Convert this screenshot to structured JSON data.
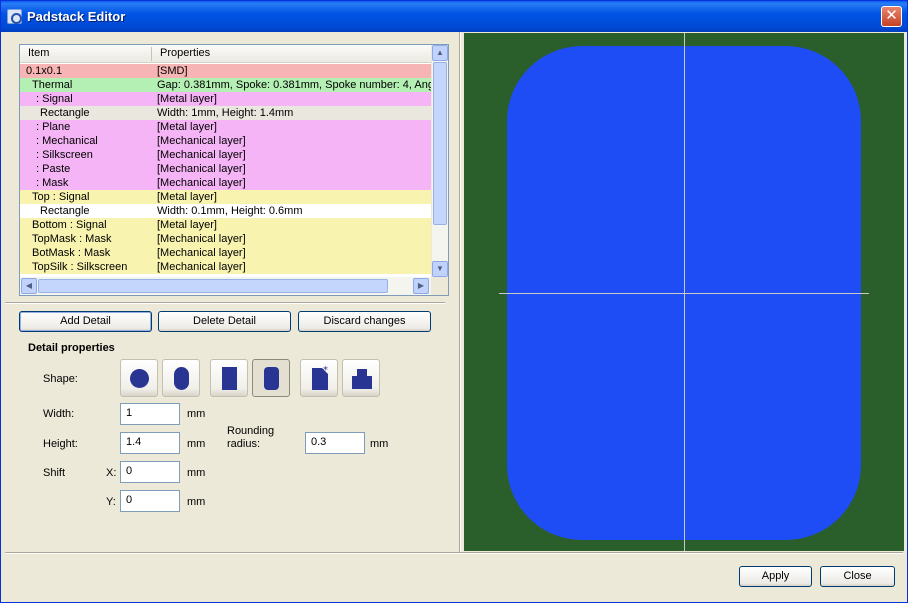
{
  "window": {
    "title": "Padstack Editor",
    "close_glyph": "✕"
  },
  "tree": {
    "columns": [
      "Item",
      "Properties"
    ],
    "rows": [
      {
        "item": "0.1x0.1",
        "props": "[SMD]",
        "bg": "#f7b4b4",
        "indent": 0
      },
      {
        "item": "Thermal",
        "props": "Gap: 0.381mm, Spoke: 0.381mm, Spoke number: 4, Ang",
        "bg": "#b4f0b4",
        "indent": 1
      },
      {
        "item": ": Signal",
        "props": "[Metal layer]",
        "bg": "#f5b4f5",
        "indent": 2
      },
      {
        "item": "Rectangle",
        "props": "Width: 1mm, Height: 1.4mm",
        "bg": "#e9e7de",
        "indent": 3
      },
      {
        "item": ": Plane",
        "props": "[Metal layer]",
        "bg": "#f5b4f5",
        "indent": 2
      },
      {
        "item": ": Mechanical",
        "props": "[Mechanical layer]",
        "bg": "#f5b4f5",
        "indent": 2
      },
      {
        "item": ": Silkscreen",
        "props": "[Mechanical layer]",
        "bg": "#f5b4f5",
        "indent": 2
      },
      {
        "item": ": Paste",
        "props": "[Mechanical layer]",
        "bg": "#f5b4f5",
        "indent": 2
      },
      {
        "item": ": Mask",
        "props": "[Mechanical layer]",
        "bg": "#f5b4f5",
        "indent": 2
      },
      {
        "item": "Top : Signal",
        "props": "[Metal layer]",
        "bg": "#f8f4b0",
        "indent": 1
      },
      {
        "item": "Rectangle",
        "props": "Width: 0.1mm, Height: 0.6mm",
        "bg": "#ffffff",
        "indent": 3
      },
      {
        "item": "Bottom : Signal",
        "props": "[Metal layer]",
        "bg": "#f8f4b0",
        "indent": 1
      },
      {
        "item": "TopMask : Mask",
        "props": "[Mechanical layer]",
        "bg": "#f8f4b0",
        "indent": 1
      },
      {
        "item": "BotMask : Mask",
        "props": "[Mechanical layer]",
        "bg": "#f8f4b0",
        "indent": 1
      },
      {
        "item": "TopSilk : Silkscreen",
        "props": "[Mechanical layer]",
        "bg": "#f8f4b0",
        "indent": 1
      }
    ]
  },
  "buttons": {
    "add_detail": "Add Detail",
    "delete_detail": "Delete Detail",
    "discard_changes": "Discard changes",
    "apply": "Apply",
    "close": "Close"
  },
  "detail": {
    "section_title": "Detail properties",
    "shape_label": "Shape:",
    "shapes": [
      "circle-shape",
      "obround-shape",
      "rectangle-shape",
      "rounded-rectangle-shape",
      "custom-shape",
      "polygon-shape"
    ],
    "selected_shape": "rounded-rectangle-shape",
    "width_label": "Width:",
    "width_value": "1",
    "height_label": "Height:",
    "height_value": "1.4",
    "rounding_label_1": "Rounding",
    "rounding_label_2": "radius:",
    "rounding_value": "0.3",
    "shift_label": "Shift",
    "x_label": "X:",
    "x_value": "0",
    "y_label": "Y:",
    "y_value": "0",
    "unit": "mm"
  },
  "colors": {
    "preview_bg": "#2a5e2a",
    "pad": "#1f4df5",
    "crosshair": "#c9c9c9"
  }
}
